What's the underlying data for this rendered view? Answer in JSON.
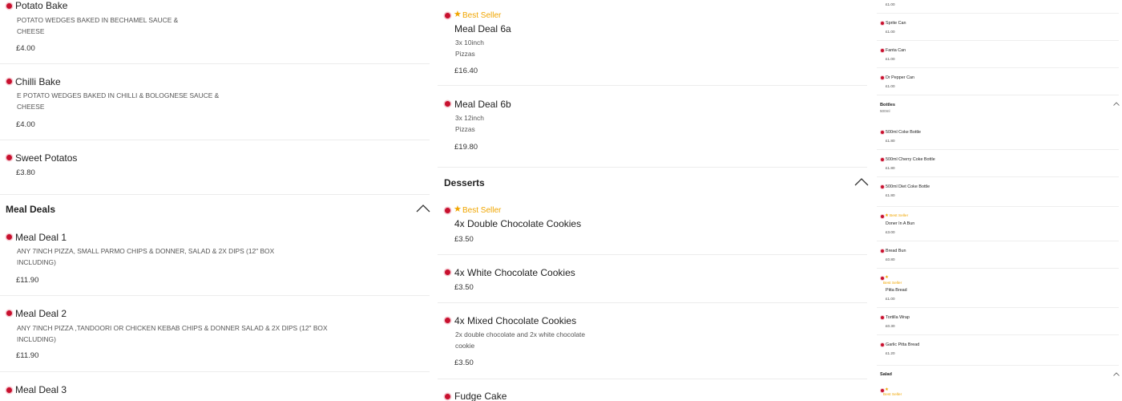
{
  "colors": {
    "accent": "#c8102e",
    "best_seller": "#f0a500"
  },
  "left": {
    "items": [
      {
        "name": "Potato Bake",
        "desc_lines": [
          "POTATO WEDGES BAKED IN BECHAMEL SAUCE &",
          "CHEESE"
        ],
        "price": "£4.00"
      },
      {
        "name": "Chilli Bake",
        "desc_lines": [
          "E POTATO WEDGES BAKED IN CHILLI & BOLOGNESE SAUCE &",
          "CHEESE"
        ],
        "price": "£4.00"
      },
      {
        "name": "Sweet Potatos",
        "price": "£3.80"
      }
    ],
    "section": {
      "title": "Meal Deals",
      "state_icon": "chevron-up-icon"
    },
    "deals": [
      {
        "name": "Meal Deal 1",
        "desc_lines": [
          "ANY 7inch PIZZA, SMALL PARMO CHIPS & DONNER, SALAD & 2X DIPS (12\" BOX",
          "INCLUDING)"
        ],
        "price": "£11.90"
      },
      {
        "name": "Meal Deal 2",
        "desc_lines": [
          "ANY 7inch PIZZA ,TANDOORI OR CHICKEN KEBAB CHIPS & DONNER SALAD & 2X DIPS (12\" BOX",
          "INCLUDING)"
        ],
        "price": "£11.90"
      },
      {
        "name": "Meal Deal 3"
      }
    ]
  },
  "middle": {
    "items": [
      {
        "badge": "Best Seller",
        "name": "Meal Deal 6a",
        "desc_lines": [
          "3x 10inch",
          "Pizzas"
        ],
        "price": "£16.40"
      },
      {
        "name": "Meal Deal 6b",
        "desc_lines": [
          "3x 12inch",
          "Pizzas"
        ],
        "price": "£19.80"
      }
    ],
    "section": {
      "title": "Desserts",
      "state_icon": "chevron-up-icon"
    },
    "desserts": [
      {
        "badge": "Best Seller",
        "name": "4x Double Chocolate Cookies",
        "price": "£3.50"
      },
      {
        "name": "4x White Chocolate Cookies",
        "price": "£3.50"
      },
      {
        "name": "4x Mixed Chocolate Cookies",
        "desc_lines": [
          "2x double chocolate and 2x white chocolate",
          "cookie"
        ],
        "price": "£3.50"
      },
      {
        "name": "Fudge Cake"
      }
    ]
  },
  "right": {
    "top_price": "£1.00",
    "cans": [
      {
        "name": "Sprite Can",
        "price": "£1.00"
      },
      {
        "name": "Fanta Can",
        "price": "£1.00"
      },
      {
        "name": "Dr Pepper Can",
        "price": "£1.00"
      }
    ],
    "bottles_section": {
      "title": "Bottles",
      "subtitle": "500ml",
      "state_icon": "chevron-up-icon"
    },
    "bottles": [
      {
        "name": "500ml Coke Bottle",
        "price": "£1.80"
      },
      {
        "name": "500ml Cherry Coke Bottle",
        "price": "£1.80"
      },
      {
        "name": "500ml Diet Coke Bottle",
        "price": "£1.80"
      }
    ],
    "extras": [
      {
        "badge": "Best Seller",
        "name": "Doner In A Bun",
        "price": "£3.00"
      },
      {
        "name": "Bread Bun",
        "price": "£0.80"
      },
      {
        "badge": "Best Seller",
        "name": "Pitta Bread",
        "price": "£1.00"
      },
      {
        "name": "Tortilla Wrap",
        "price": "£0.30"
      },
      {
        "name": "Garlic Pitta Bread",
        "price": "£1.20"
      }
    ],
    "salad_section": {
      "title": "Salad",
      "state_icon": "chevron-up-icon"
    },
    "salad_first": {
      "badge": "Best Seller"
    }
  }
}
